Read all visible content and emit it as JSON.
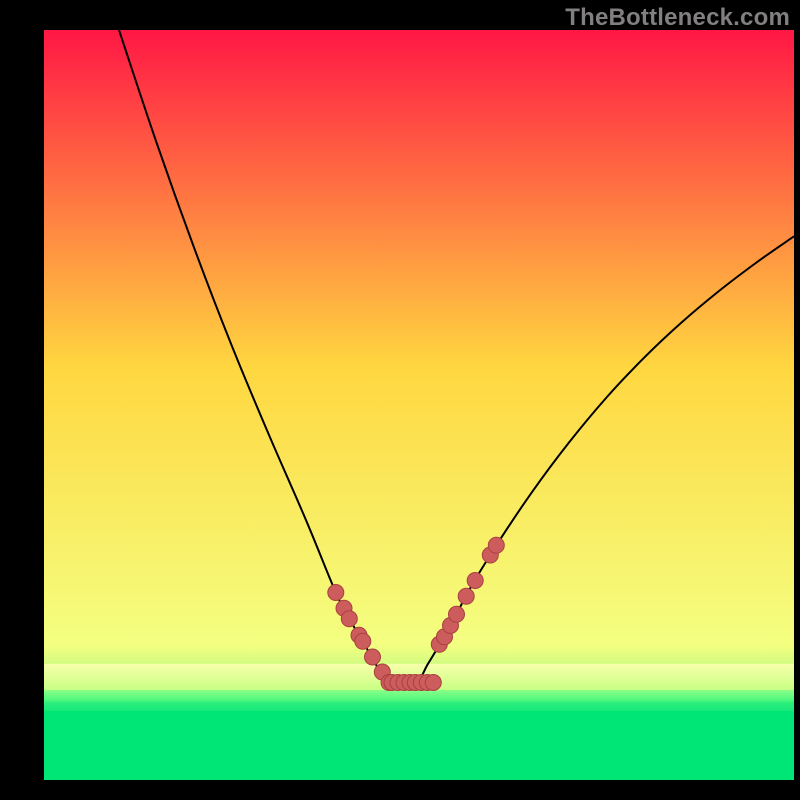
{
  "watermark": "TheBottleneck.com",
  "chart_data": {
    "type": "line",
    "title": "",
    "xlabel": "",
    "ylabel": "",
    "xlim": [
      0,
      100
    ],
    "ylim": [
      0,
      100
    ],
    "gradient_colors": {
      "top": "#ff1744",
      "mid_upper": "#ffd740",
      "mid_lower": "#f4ff81",
      "bottom": "#00e676"
    },
    "curve_color": "#000000",
    "dot_fill": "#cd5c5c",
    "dot_stroke": "#a94040",
    "series": [
      {
        "name": "curve",
        "x": [
          10,
          15,
          20,
          25,
          30,
          35,
          38.9,
          40.7,
          42.5,
          44.2,
          46.0,
          49.5,
          51.2,
          53.0,
          54.7,
          56.5,
          60,
          65,
          70,
          75,
          80,
          85,
          90,
          95,
          100
        ],
        "y": [
          100,
          85,
          71,
          58,
          46,
          34.5,
          25,
          21.5,
          18.5,
          15.5,
          13,
          13,
          15.5,
          18.5,
          21.5,
          25,
          30.8,
          38.3,
          45,
          51,
          56.3,
          61,
          65.2,
          69,
          72.5
        ]
      }
    ],
    "dots_left": [
      {
        "x": 38.9,
        "y": 25.0
      },
      {
        "x": 40.0,
        "y": 22.9
      },
      {
        "x": 40.7,
        "y": 21.5
      },
      {
        "x": 42.0,
        "y": 19.3
      },
      {
        "x": 42.5,
        "y": 18.5
      },
      {
        "x": 43.8,
        "y": 16.4
      },
      {
        "x": 45.1,
        "y": 14.4
      },
      {
        "x": 46.0,
        "y": 13.0
      }
    ],
    "dots_bottom": [
      {
        "x": 46.4,
        "y": 13.0
      },
      {
        "x": 47.2,
        "y": 13.0
      },
      {
        "x": 48.0,
        "y": 13.0
      },
      {
        "x": 48.8,
        "y": 13.0
      },
      {
        "x": 49.5,
        "y": 13.0
      },
      {
        "x": 50.3,
        "y": 13.0
      },
      {
        "x": 51.1,
        "y": 13.0
      },
      {
        "x": 51.9,
        "y": 13.0
      }
    ],
    "dots_right": [
      {
        "x": 52.7,
        "y": 18.1
      },
      {
        "x": 53.4,
        "y": 19.1
      },
      {
        "x": 54.2,
        "y": 20.6
      },
      {
        "x": 55.0,
        "y": 22.1
      },
      {
        "x": 56.3,
        "y": 24.5
      },
      {
        "x": 57.5,
        "y": 26.6
      },
      {
        "x": 59.5,
        "y": 30.0
      },
      {
        "x": 60.3,
        "y": 31.3
      }
    ],
    "bottom_bands": [
      {
        "y0": 15.5,
        "y1": 12.0,
        "top_color": "#f8ffaa",
        "bot_color": "#c8ff84"
      },
      {
        "y0": 12.0,
        "y1": 10.5,
        "top_color": "#8cff88",
        "bot_color": "#46f77e"
      },
      {
        "y0": 10.5,
        "y1": 9.2,
        "top_color": "#2ff07d",
        "bot_color": "#16e87a"
      },
      {
        "y0": 9.2,
        "y1": 0.0,
        "top_color": "#00e676",
        "bot_color": "#00e676"
      }
    ]
  }
}
